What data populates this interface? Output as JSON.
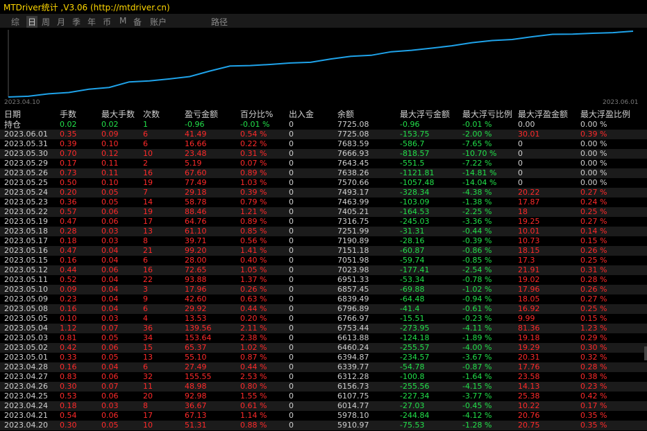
{
  "window": {
    "title": "MTDriver统计 ,V3.06 (http://mtdriver.cn)"
  },
  "tabs": [
    {
      "label": "综"
    },
    {
      "label": "日",
      "active": true
    },
    {
      "label": "周"
    },
    {
      "label": "月"
    },
    {
      "label": "季"
    },
    {
      "label": "年"
    },
    {
      "label": "币"
    },
    {
      "label": "M"
    },
    {
      "label": "备"
    },
    {
      "label": "账户"
    },
    {
      "label": "路径"
    }
  ],
  "colors": {
    "line": "#1fa3ea",
    "red": "#ff2a2a",
    "green": "#22e04a",
    "text": "#d0d0d0"
  },
  "chart_data": {
    "type": "line",
    "x_start_label": "2023.04.10",
    "x_end_label": "2023.06.01",
    "values": [
      5890,
      5911,
      5978,
      6015,
      6108,
      6157,
      6312,
      6340,
      6394,
      6460,
      6614,
      6753,
      6767,
      6797,
      6839,
      6857,
      6951,
      7024,
      7052,
      7151,
      7191,
      7252,
      7317,
      7405,
      7464,
      7493,
      7571,
      7638,
      7643,
      7667,
      7684,
      7725
    ]
  },
  "table": {
    "headers": [
      "日期",
      "手数",
      "最大手数",
      "次数",
      "盈亏金额",
      "百分比%",
      "出入金",
      "余额",
      "最大浮亏金额",
      "最大浮亏比例",
      "最大浮盈金额",
      "最大浮盈比例"
    ],
    "rows": [
      [
        "持仓",
        "0.02",
        "0.02",
        "1",
        "-0.96",
        "-0.01 %",
        "0",
        "7725.08",
        "-0.96",
        "-0.01 %",
        "0.00",
        "0.00 %"
      ],
      [
        "2023.06.01",
        "0.35",
        "0.09",
        "6",
        "41.49",
        "0.54 %",
        "0",
        "7725.08",
        "-153.75",
        "-2.00 %",
        "30.01",
        "0.39 %"
      ],
      [
        "2023.05.31",
        "0.39",
        "0.10",
        "6",
        "16.66",
        "0.22 %",
        "0",
        "7683.59",
        "-586.7",
        "-7.65 %",
        "0",
        "0.00 %"
      ],
      [
        "2023.05.30",
        "0.70",
        "0.12",
        "10",
        "23.48",
        "0.31 %",
        "0",
        "7666.93",
        "-818.57",
        "-10.70 %",
        "0",
        "0.00 %"
      ],
      [
        "2023.05.29",
        "0.17",
        "0.11",
        "2",
        "5.19",
        "0.07 %",
        "0",
        "7643.45",
        "-551.5",
        "-7.22 %",
        "0",
        "0.00 %"
      ],
      [
        "2023.05.26",
        "0.73",
        "0.11",
        "16",
        "67.60",
        "0.89 %",
        "0",
        "7638.26",
        "-1121.81",
        "-14.81 %",
        "0",
        "0.00 %"
      ],
      [
        "2023.05.25",
        "0.50",
        "0.10",
        "19",
        "77.49",
        "1.03 %",
        "0",
        "7570.66",
        "-1057.48",
        "-14.04 %",
        "0",
        "0.00 %"
      ],
      [
        "2023.05.24",
        "0.20",
        "0.05",
        "7",
        "29.18",
        "0.39 %",
        "0",
        "7493.17",
        "-328.34",
        "-4.38 %",
        "20.22",
        "0.27 %"
      ],
      [
        "2023.05.23",
        "0.36",
        "0.05",
        "14",
        "58.78",
        "0.79 %",
        "0",
        "7463.99",
        "-103.09",
        "-1.38 %",
        "17.87",
        "0.24 %"
      ],
      [
        "2023.05.22",
        "0.57",
        "0.06",
        "19",
        "88.46",
        "1.21 %",
        "0",
        "7405.21",
        "-164.53",
        "-2.25 %",
        "18",
        "0.25 %"
      ],
      [
        "2023.05.19",
        "0.47",
        "0.06",
        "17",
        "64.76",
        "0.89 %",
        "0",
        "7316.75",
        "-245.03",
        "-3.36 %",
        "19.25",
        "0.27 %"
      ],
      [
        "2023.05.18",
        "0.28",
        "0.03",
        "13",
        "61.10",
        "0.85 %",
        "0",
        "7251.99",
        "-31.31",
        "-0.44 %",
        "10.01",
        "0.14 %"
      ],
      [
        "2023.05.17",
        "0.18",
        "0.03",
        "8",
        "39.71",
        "0.56 %",
        "0",
        "7190.89",
        "-28.16",
        "-0.39 %",
        "10.73",
        "0.15 %"
      ],
      [
        "2023.05.16",
        "0.47",
        "0.04",
        "21",
        "99.20",
        "1.41 %",
        "0",
        "7151.18",
        "-60.87",
        "-0.86 %",
        "18.15",
        "0.26 %"
      ],
      [
        "2023.05.15",
        "0.16",
        "0.04",
        "6",
        "28.00",
        "0.40 %",
        "0",
        "7051.98",
        "-59.74",
        "-0.85 %",
        "17.3",
        "0.25 %"
      ],
      [
        "2023.05.12",
        "0.44",
        "0.06",
        "16",
        "72.65",
        "1.05 %",
        "0",
        "7023.98",
        "-177.41",
        "-2.54 %",
        "21.91",
        "0.31 %"
      ],
      [
        "2023.05.11",
        "0.52",
        "0.04",
        "22",
        "93.88",
        "1.37 %",
        "0",
        "6951.33",
        "-53.34",
        "-0.78 %",
        "19.02",
        "0.28 %"
      ],
      [
        "2023.05.10",
        "0.09",
        "0.04",
        "3",
        "17.96",
        "0.26 %",
        "0",
        "6857.45",
        "-69.88",
        "-1.02 %",
        "17.96",
        "0.26 %"
      ],
      [
        "2023.05.09",
        "0.23",
        "0.04",
        "9",
        "42.60",
        "0.63 %",
        "0",
        "6839.49",
        "-64.48",
        "-0.94 %",
        "18.05",
        "0.27 %"
      ],
      [
        "2023.05.08",
        "0.16",
        "0.04",
        "6",
        "29.92",
        "0.44 %",
        "0",
        "6796.89",
        "-41.4",
        "-0.61 %",
        "16.92",
        "0.25 %"
      ],
      [
        "2023.05.05",
        "0.10",
        "0.03",
        "4",
        "13.53",
        "0.20 %",
        "0",
        "6766.97",
        "-15.51",
        "-0.23 %",
        "9.99",
        "0.15 %"
      ],
      [
        "2023.05.04",
        "1.12",
        "0.07",
        "36",
        "139.56",
        "2.11 %",
        "0",
        "6753.44",
        "-273.95",
        "-4.11 %",
        "81.36",
        "1.23 %"
      ],
      [
        "2023.05.03",
        "0.81",
        "0.05",
        "34",
        "153.64",
        "2.38 %",
        "0",
        "6613.88",
        "-124.18",
        "-1.89 %",
        "19.18",
        "0.29 %"
      ],
      [
        "2023.05.02",
        "0.42",
        "0.06",
        "15",
        "65.37",
        "1.02 %",
        "0",
        "6460.24",
        "-255.57",
        "-4.00 %",
        "19.29",
        "0.30 %"
      ],
      [
        "2023.05.01",
        "0.33",
        "0.05",
        "13",
        "55.10",
        "0.87 %",
        "0",
        "6394.87",
        "-234.57",
        "-3.67 %",
        "20.31",
        "0.32 %"
      ],
      [
        "2023.04.28",
        "0.16",
        "0.04",
        "6",
        "27.49",
        "0.44 %",
        "0",
        "6339.77",
        "-54.78",
        "-0.87 %",
        "17.76",
        "0.28 %"
      ],
      [
        "2023.04.27",
        "0.83",
        "0.06",
        "32",
        "155.55",
        "2.53 %",
        "0",
        "6312.28",
        "-100.8",
        "-1.64 %",
        "23.58",
        "0.38 %"
      ],
      [
        "2023.04.26",
        "0.30",
        "0.07",
        "11",
        "48.98",
        "0.80 %",
        "0",
        "6156.73",
        "-255.56",
        "-4.15 %",
        "14.13",
        "0.23 %"
      ],
      [
        "2023.04.25",
        "0.53",
        "0.06",
        "20",
        "92.98",
        "1.55 %",
        "0",
        "6107.75",
        "-227.34",
        "-3.77 %",
        "25.38",
        "0.42 %"
      ],
      [
        "2023.04.24",
        "0.18",
        "0.03",
        "8",
        "36.67",
        "0.61 %",
        "0",
        "6014.77",
        "-27.03",
        "-0.45 %",
        "10.22",
        "0.17 %"
      ],
      [
        "2023.04.21",
        "0.54",
        "0.06",
        "17",
        "67.13",
        "1.14 %",
        "0",
        "5978.10",
        "-244.84",
        "-4.12 %",
        "20.76",
        "0.35 %"
      ],
      [
        "2023.04.20",
        "0.30",
        "0.05",
        "10",
        "51.31",
        "0.88 %",
        "0",
        "5910.97",
        "-75.53",
        "-1.28 %",
        "20.75",
        "0.35 %"
      ]
    ]
  }
}
